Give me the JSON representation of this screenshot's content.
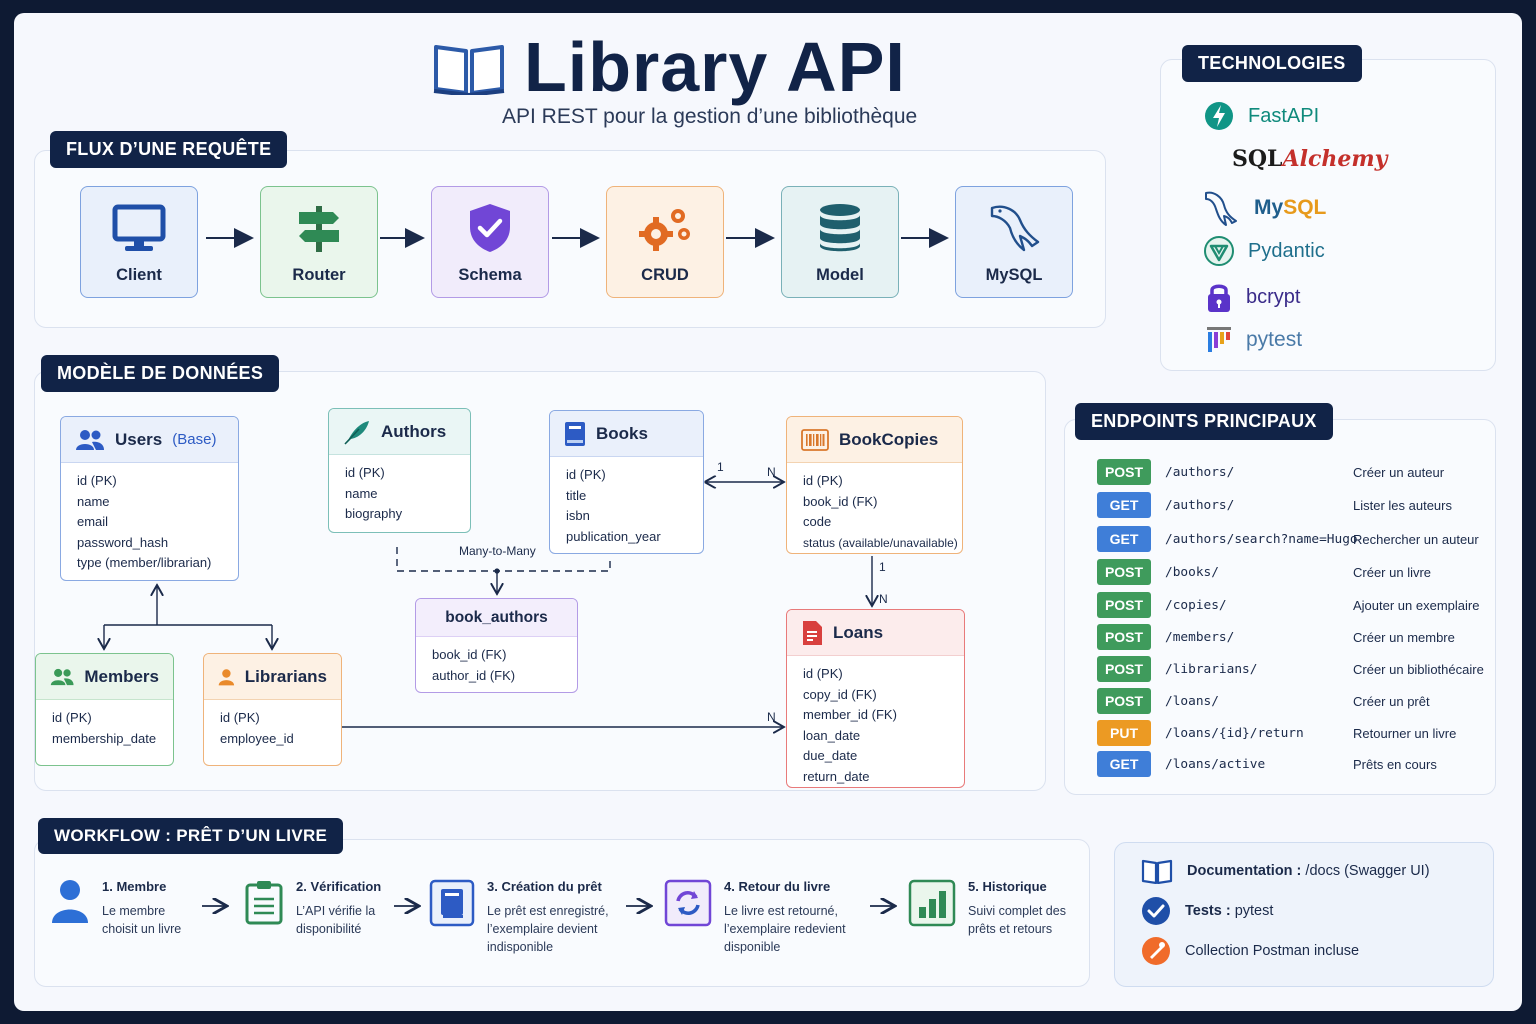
{
  "header": {
    "title": "Library API",
    "subtitle": "API REST pour la gestion d’une bibliothèque"
  },
  "flow": {
    "tag": "FLUX D’UNE REQUÊTE",
    "steps": [
      {
        "label": "Client",
        "color": "#3b6fd1"
      },
      {
        "label": "Router",
        "color": "#4aa564"
      },
      {
        "label": "Schema",
        "color": "#7d56d6"
      },
      {
        "label": "CRUD",
        "color": "#e9903a"
      },
      {
        "label": "Model",
        "color": "#2f7d8a"
      },
      {
        "label": "MySQL",
        "color": "#3b6fd1"
      }
    ]
  },
  "technologies": {
    "tag": "TECHNOLOGIES",
    "items": [
      "FastAPI",
      "SQLAlchemy",
      "MySQL",
      "Pydantic",
      "bcrypt",
      "pytest"
    ],
    "sqlalchemy_parts": [
      "SQL",
      "Alchemy"
    ],
    "mysql_parts": [
      "My",
      "SQL"
    ]
  },
  "data_model": {
    "tag": "MODÈLE DE DONNÉES",
    "users": {
      "name": "Users",
      "sub": "(Base)",
      "fields": [
        "id (PK)",
        "name",
        "email",
        "password_hash",
        "type (member/librarian)"
      ]
    },
    "authors": {
      "name": "Authors",
      "fields": [
        "id (PK)",
        "name",
        "biography"
      ]
    },
    "books": {
      "name": "Books",
      "fields": [
        "id (PK)",
        "title",
        "isbn",
        "publication_year"
      ]
    },
    "bookcopies": {
      "name": "BookCopies",
      "fields": [
        "id (PK)",
        "book_id (FK)",
        "code",
        "status (available/unavailable)"
      ]
    },
    "book_authors": {
      "name": "book_authors",
      "fields": [
        "book_id (FK)",
        "author_id (FK)"
      ]
    },
    "members": {
      "name": "Members",
      "fields": [
        "id (PK)",
        "membership_date"
      ]
    },
    "librarians": {
      "name": "Librarians",
      "fields": [
        "id (PK)",
        "employee_id"
      ]
    },
    "loans": {
      "name": "Loans",
      "fields": [
        "id (PK)",
        "copy_id (FK)",
        "member_id (FK)",
        "loan_date",
        "due_date",
        "return_date"
      ]
    },
    "relations": {
      "many_to_many": "Many-to-Many",
      "one": "1",
      "n": "N"
    }
  },
  "endpoints": {
    "tag": "ENDPOINTS PRINCIPAUX",
    "items": [
      {
        "method": "POST",
        "path": "/authors/",
        "desc": "Créer un auteur",
        "color": "#3f9b5c"
      },
      {
        "method": "GET",
        "path": "/authors/",
        "desc": "Lister les auteurs",
        "color": "#3f7ed8"
      },
      {
        "method": "GET",
        "path": "/authors/search?name=Hugo",
        "desc": "Rechercher un auteur",
        "color": "#3f7ed8"
      },
      {
        "method": "POST",
        "path": "/books/",
        "desc": "Créer un livre",
        "color": "#3f9b5c"
      },
      {
        "method": "POST",
        "path": "/copies/",
        "desc": "Ajouter un exemplaire",
        "color": "#3f9b5c"
      },
      {
        "method": "POST",
        "path": "/members/",
        "desc": "Créer un membre",
        "color": "#3f9b5c"
      },
      {
        "method": "POST",
        "path": "/librarians/",
        "desc": "Créer un bibliothécaire",
        "color": "#3f9b5c"
      },
      {
        "method": "POST",
        "path": "/loans/",
        "desc": "Créer un prêt",
        "color": "#3f9b5c"
      },
      {
        "method": "PUT",
        "path": "/loans/{id}/return",
        "desc": "Retourner un livre",
        "color": "#ec9a23"
      },
      {
        "method": "GET",
        "path": "/loans/active",
        "desc": "Prêts en cours",
        "color": "#3f7ed8"
      }
    ]
  },
  "workflow": {
    "tag": "WORKFLOW : PRÊT D’UN LIVRE",
    "steps": [
      {
        "title": "1. Membre",
        "desc": [
          "Le membre",
          "choisit un livre"
        ]
      },
      {
        "title": "2. Vérification",
        "desc": [
          "L’API vérifie la",
          "disponibilité"
        ]
      },
      {
        "title": "3. Création du prêt",
        "desc": [
          "Le prêt est enregistré,",
          "l’exemplaire devient",
          "indisponible"
        ]
      },
      {
        "title": "4. Retour du livre",
        "desc": [
          "Le livre est retourné,",
          "l’exemplaire redevient",
          "disponible"
        ]
      },
      {
        "title": "5. Historique",
        "desc": [
          "Suivi complet des",
          "prêts et retours"
        ]
      }
    ]
  },
  "info": {
    "doc_label": "Documentation :",
    "doc_value": "/docs (Swagger UI)",
    "tests_label": "Tests :",
    "tests_value": "pytest",
    "postman": "Collection Postman incluse"
  }
}
